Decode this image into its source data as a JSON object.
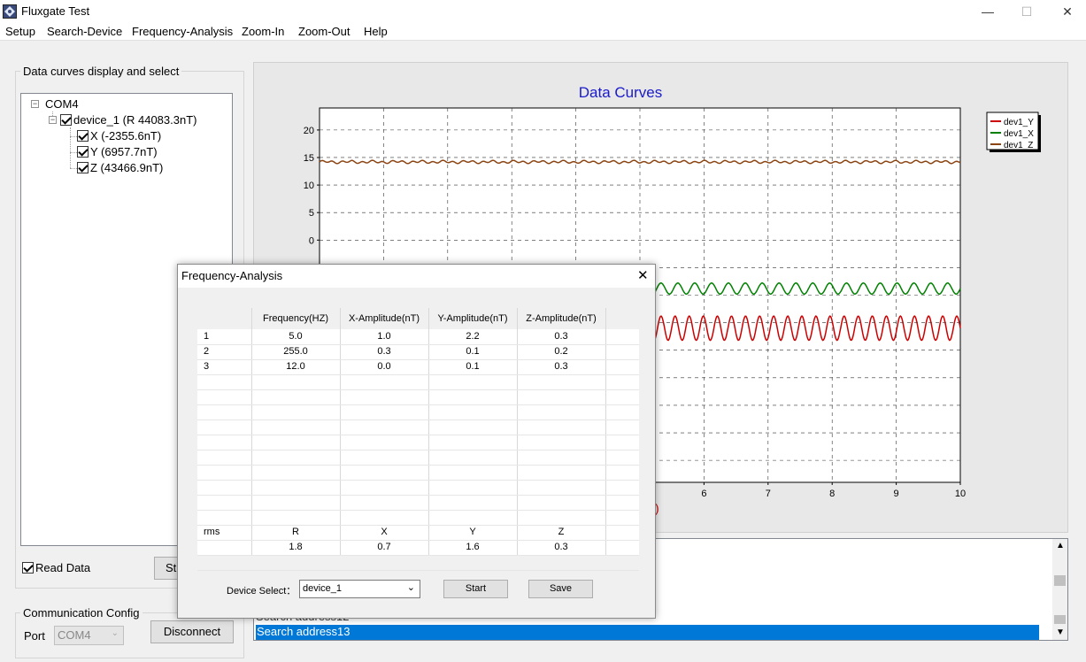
{
  "window": {
    "title": "Fluxgate Test",
    "minimize": "—",
    "maximize": "☐",
    "close": "✕"
  },
  "menu": [
    "Setup",
    "Search-Device",
    "Frequency-Analysis",
    "Zoom-In",
    "Zoom-Out",
    "Help"
  ],
  "left_panel": {
    "group_title": "Data curves display and select",
    "tree": {
      "port": "COM4",
      "device": "device_1  (R 44083.3nT)",
      "channels": [
        "X (-2355.6nT)",
        "Y (6957.7nT)",
        "Z (43466.9nT)"
      ]
    },
    "read_data_label": "Read Data",
    "start_partial": "St"
  },
  "comm_config": {
    "group_title": "Communication Config",
    "port_label": "Port",
    "port_value": "COM4",
    "disconnect": "Disconnect"
  },
  "chart_data": {
    "type": "line",
    "title": "Data Curves",
    "x_ticks": [
      "6",
      "7",
      "8",
      "9",
      "10"
    ],
    "y_ticks": [
      "20",
      "15",
      "10",
      "5",
      "0"
    ],
    "xlim": [
      0,
      10
    ],
    "grid": true,
    "legend_position": "top-right",
    "series": [
      {
        "name": "dev1_Y",
        "color": "#cc0000",
        "level": -16.0,
        "amplitude": 2.2
      },
      {
        "name": "dev1_X",
        "color": "#008000",
        "level": -8.8,
        "amplitude": 1.0
      },
      {
        "name": "dev1_Z",
        "color": "#8b4513",
        "level": 14.2,
        "amplitude": 0.3
      }
    ]
  },
  "log": {
    "lines": [
      "Search address12",
      "Search address13"
    ],
    "selected_index": 1,
    "glyph": ")"
  },
  "dialog": {
    "title": "Frequency-Analysis",
    "columns": [
      "",
      "Frequency(HZ)",
      "X-Amplitude(nT)",
      "Y-Amplitude(nT)",
      "Z-Amplitude(nT)"
    ],
    "rows": [
      [
        "1",
        "5.0",
        "1.0",
        "2.2",
        "0.3"
      ],
      [
        "2",
        "255.0",
        "0.3",
        "0.1",
        "0.2"
      ],
      [
        "3",
        "12.0",
        "0.0",
        "0.1",
        "0.3"
      ]
    ],
    "rms_header": [
      "rms",
      "R",
      "X",
      "Y",
      "Z"
    ],
    "rms_values": [
      "",
      "1.8",
      "0.7",
      "1.6",
      "0.3"
    ],
    "device_select_label": "Device Select：",
    "device_value": "device_1",
    "start": "Start",
    "save": "Save"
  }
}
